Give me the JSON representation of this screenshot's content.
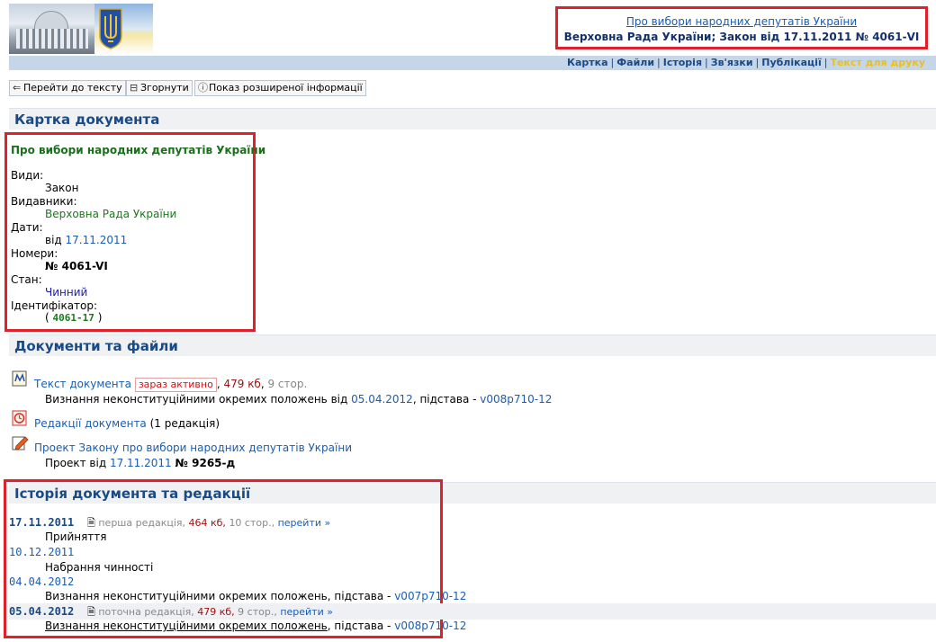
{
  "header": {
    "title_link": "Про вибори народних депутатів України",
    "title_sub": "Верховна Рада України; Закон від 17.11.2011 № 4061-VI"
  },
  "nav": {
    "items": [
      "Картка",
      "Файли",
      "Історія",
      "Зв'язки",
      "Публікації"
    ],
    "active": "Текст для друку",
    "sep": "|"
  },
  "toolbar": {
    "goto_text": "Перейти до тексту",
    "collapse": "Згорнути",
    "show_more": "Показ розширеної інформації"
  },
  "card": {
    "section_title": "Картка документа",
    "doc_title": "Про вибори народних депутатів України",
    "types_label": "Види:",
    "types_value": "Закон",
    "publishers_label": "Видавники:",
    "publishers_value": "Верховна Рада України",
    "dates_label": "Дати:",
    "dates_prefix": "від",
    "dates_value": "17.11.2011",
    "numbers_label": "Номери:",
    "numbers_value": "№ 4061-VI",
    "state_label": "Стан:",
    "state_value": "Чинний",
    "id_label": "Ідентифікатор:",
    "id_open": "(",
    "id_value": "4061-17",
    "id_close": ")"
  },
  "docs": {
    "section_title": "Документи та файли",
    "text_doc": {
      "link": "Текст документа",
      "badge": "зараз активно",
      "size": "479 кб",
      "pages": "9 стор.",
      "note_prefix": "Визнання неконституційними окремих положень від",
      "note_date": "05.04.2012",
      "note_mid": ", підстава -",
      "note_ref": "v008p710-12"
    },
    "redactions": {
      "link": "Редакції документа",
      "count": "(1 редакція)"
    },
    "project": {
      "link": "Проект Закону про вибори народних депутатів України",
      "prefix": "Проект від",
      "date": "17.11.2011",
      "number": "№ 9265-д"
    }
  },
  "history": {
    "section_title": "Історія документа та редакції",
    "rows": [
      {
        "date": "17.11.2011",
        "kind": "перша редакція,",
        "size": "464 кб,",
        "pages": "10 стор.,",
        "go": "перейти »",
        "text": "Прийняття"
      },
      {
        "date": "10.12.2011",
        "text": "Набрання чинності"
      },
      {
        "date": "04.04.2012",
        "text_prefix": "Визнання неконституційними окремих положень, підстава -",
        "ref": "v007p710-12"
      },
      {
        "date": "05.04.2012",
        "kind": "поточна редакція,",
        "size": "479 кб,",
        "pages": "9 стор.,",
        "go": "перейти »",
        "text_prefix": "Визнання неконституційними окремих положень",
        "text_suffix": ", підстава -",
        "ref": "v008p710-12"
      }
    ]
  },
  "colors": {
    "accent": "#1a4a86",
    "highlight_border": "#e0202a",
    "active_nav": "#e8c020"
  }
}
